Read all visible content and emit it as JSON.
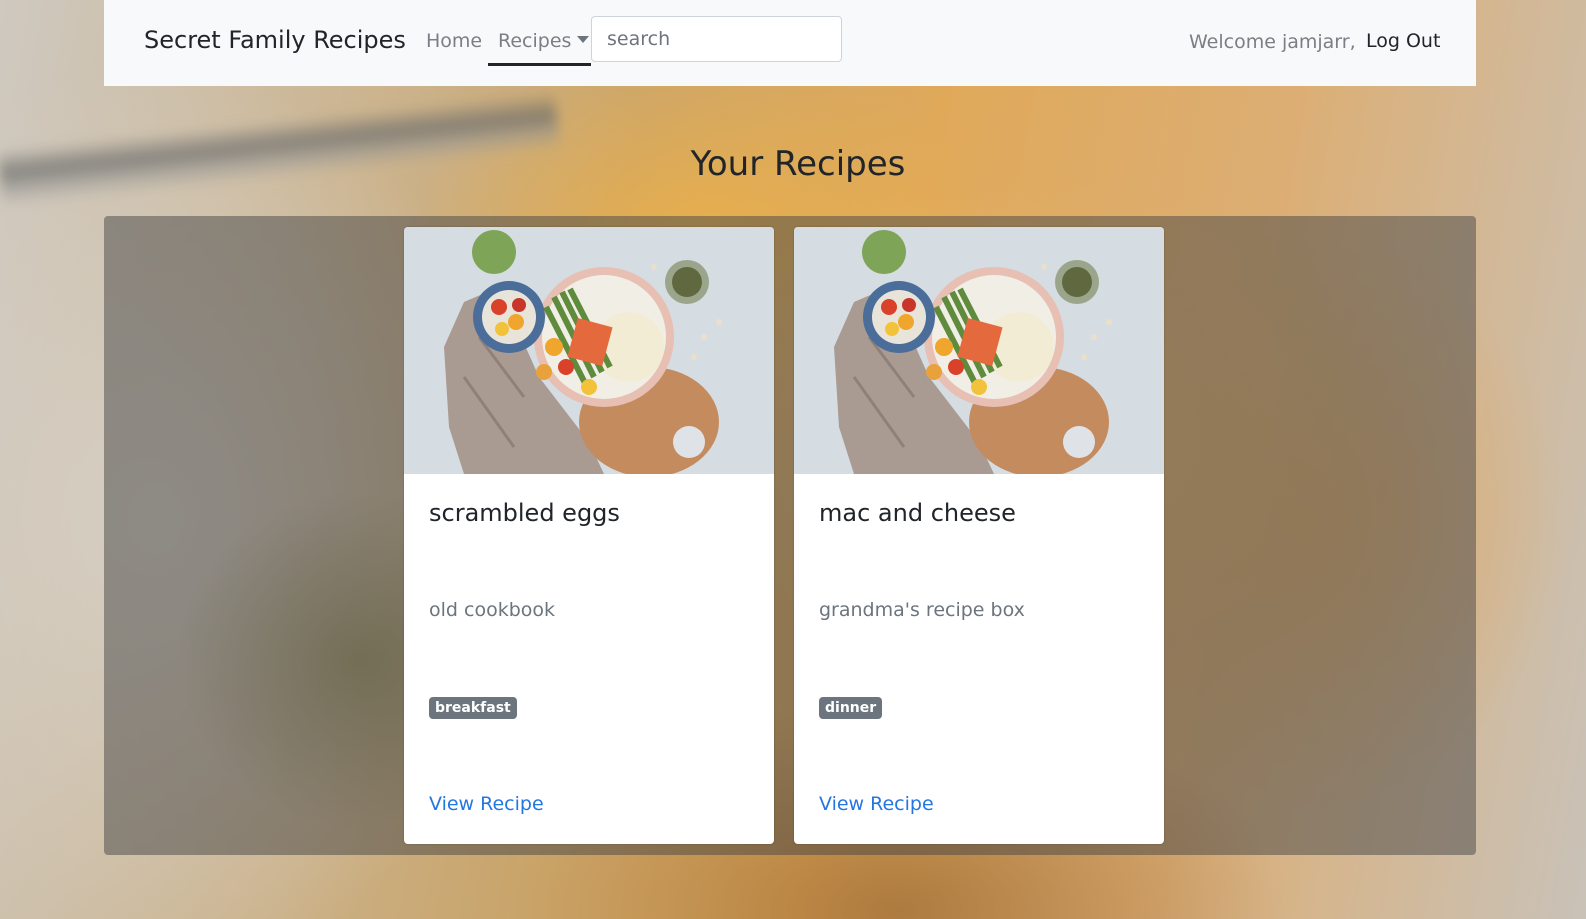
{
  "navbar": {
    "brand": "Secret Family Recipes",
    "home_label": "Home",
    "recipes_label": "Recipes",
    "search_placeholder": "search",
    "search_value": "",
    "welcome_text": "Welcome jamjarr,",
    "logout_label": "Log Out"
  },
  "main": {
    "title": "Your Recipes",
    "recipes": [
      {
        "title": "scrambled eggs",
        "source": "old cookbook",
        "category": "breakfast",
        "link_label": "View Recipe",
        "image_icon": "food-plate-photo"
      },
      {
        "title": "mac and cheese",
        "source": "grandma's recipe box",
        "category": "dinner",
        "link_label": "View Recipe",
        "image_icon": "food-plate-photo"
      }
    ]
  },
  "colors": {
    "navbar_bg": "#f8f9fa",
    "link": "#2477e0",
    "badge": "#6c757d",
    "panel_overlay": "rgba(70,70,70,0.5)"
  }
}
